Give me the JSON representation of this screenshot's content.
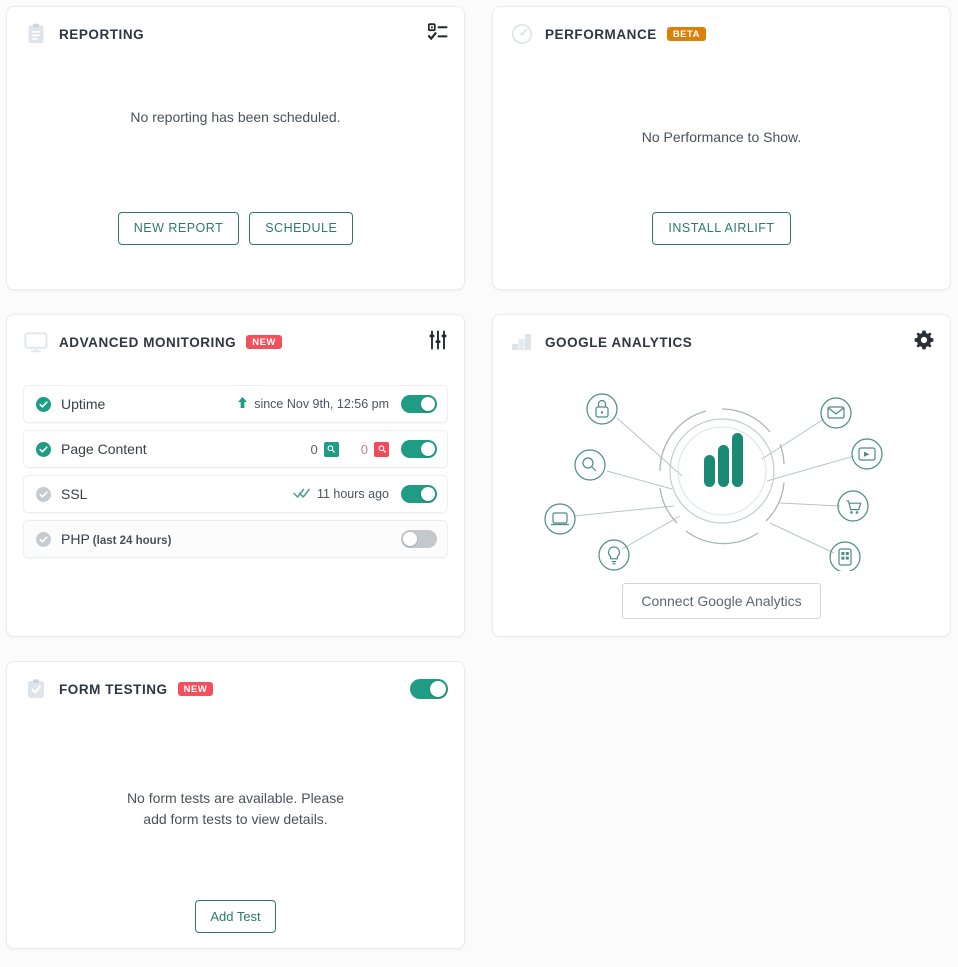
{
  "cards": {
    "reporting": {
      "title": "REPORTING",
      "icon": "clipboard-icon",
      "action_icon": "task-list-icon",
      "empty_message": "No reporting has been scheduled.",
      "buttons": [
        {
          "label": "NEW REPORT",
          "name": "new-report-button"
        },
        {
          "label": "SCHEDULE",
          "name": "schedule-button"
        }
      ]
    },
    "performance": {
      "title": "PERFORMANCE",
      "icon": "gauge-icon",
      "badge": "BETA",
      "badge_color": "#d98109",
      "empty_message": "No Performance to Show.",
      "button": "INSTALL AIRLIFT"
    },
    "advanced_monitoring": {
      "title": "ADVANCED MONITORING",
      "icon": "monitor-icon",
      "badge": "NEW",
      "badge_color": "#f2505d",
      "action_icon": "sliders-icon",
      "rows": [
        {
          "label": "Uptime",
          "sublabel": "",
          "status": "ok",
          "meta_icon": "arrow-up-icon",
          "meta": "since Nov 9th, 12:56 pm",
          "toggle": "on"
        },
        {
          "label": "Page Content",
          "sublabel": "",
          "status": "ok",
          "counts": [
            {
              "value": "0",
              "tone": "positive",
              "icon": "doc-search-icon"
            },
            {
              "value": "0",
              "tone": "negative",
              "icon": "doc-search-icon"
            }
          ],
          "toggle": "on"
        },
        {
          "label": "SSL",
          "sublabel": "",
          "status": "idle",
          "meta_icon": "double-check-icon",
          "meta": "11 hours ago",
          "toggle": "on"
        },
        {
          "label": "PHP",
          "sublabel": "(last 24 hours)",
          "status": "idle",
          "toggle": "off"
        }
      ]
    },
    "google_analytics": {
      "title": "GOOGLE ANALYTICS",
      "icon": "bar-steps-icon",
      "action_icon": "gear-icon",
      "illustration": "analytics-network-illustration",
      "button": "Connect Google Analytics"
    },
    "form_testing": {
      "title": "FORM TESTING",
      "icon": "clipboard-check-icon",
      "badge": "NEW",
      "badge_color": "#f2505d",
      "toggle": "on",
      "empty_message_line1": "No form tests are available. Please",
      "empty_message_line2": "add form tests to view details.",
      "button": "Add Test"
    }
  },
  "theme": {
    "accent": "#1f9d84",
    "link": "#2c7a6d",
    "danger": "#ef4b59",
    "muted": "#c6cbd0",
    "page_bg": "#fbfbfc"
  }
}
